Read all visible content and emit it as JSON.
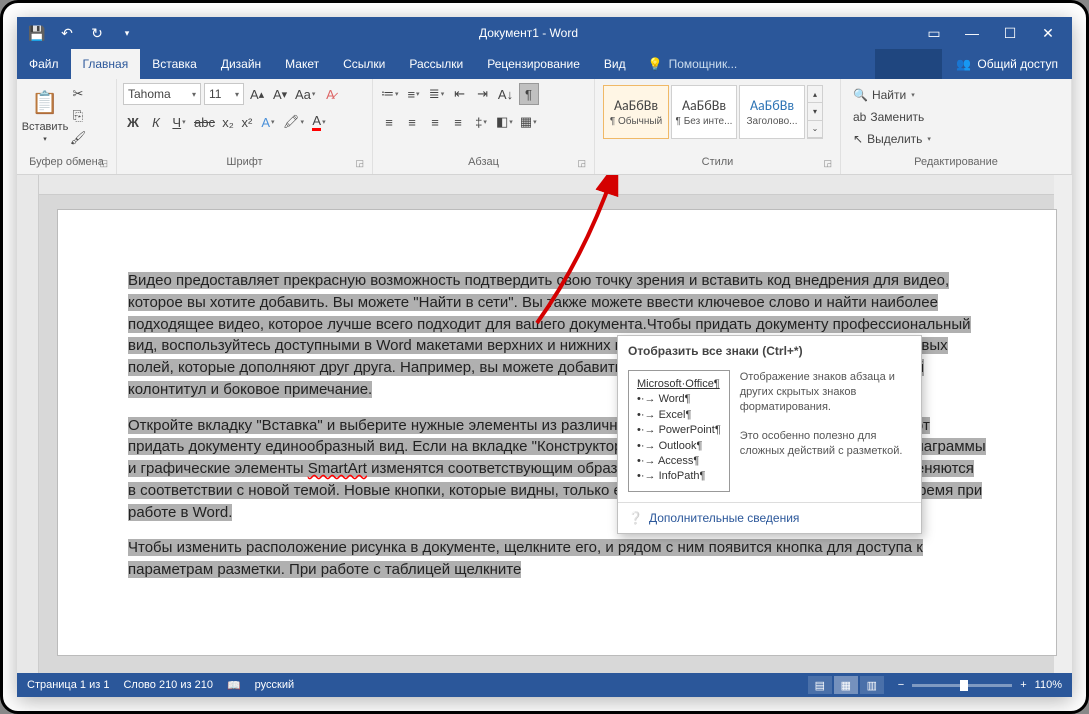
{
  "titlebar": {
    "title": "Документ1 - Word"
  },
  "tabs": {
    "file": "Файл",
    "home": "Главная",
    "insert": "Вставка",
    "design": "Дизайн",
    "layout": "Макет",
    "references": "Ссылки",
    "mailings": "Рассылки",
    "review": "Рецензирование",
    "view": "Вид",
    "tellme": "Помощник...",
    "share": "Общий доступ"
  },
  "ribbon": {
    "clipboard": {
      "label": "Буфер обмена",
      "paste": "Вставить"
    },
    "font": {
      "label": "Шрифт",
      "name": "Tahoma",
      "size": "11"
    },
    "paragraph": {
      "label": "Абзац"
    },
    "styles": {
      "label": "Стили",
      "items": [
        {
          "preview": "АаБбВв",
          "name": "¶ Обычный"
        },
        {
          "preview": "АаБбВв",
          "name": "¶ Без инте..."
        },
        {
          "preview": "АаБбВв",
          "name": "Заголово..."
        }
      ]
    },
    "editing": {
      "label": "Редактирование",
      "find": "Найти",
      "replace": "Заменить",
      "select": "Выделить"
    }
  },
  "tooltip": {
    "title": "Отобразить все знаки (Ctrl+*)",
    "sample": {
      "heading": "Microsoft·Office¶",
      "items": [
        "Word¶",
        "Excel¶",
        "PowerPoint¶",
        "Outlook¶",
        "Access¶",
        "InfoPath¶"
      ]
    },
    "desc1": "Отображение знаков абзаца и других скрытых знаков форматирования.",
    "desc2": "Это особенно полезно для сложных действий с разметкой.",
    "more": "Дополнительные сведения"
  },
  "document": {
    "p1": "Видео  предоставляет прекрасную возможность подтвердить свою точку зрения и вставить код  внедрения для видео,       которое  вы хотите добавить. Вы можете \"Найти в сети\". Вы  также можете ввести ключевое слово и найти наиболее подходящее видео, которое лучше всего подходит    для вашего документа.Чтобы  придать документу профессиональный вид, воспользуйтесь доступными в Word макетами верхних и нижних колонтитулов,       титульной страницы и текстовых   полей, которые дополняют друг друга. Например,     вы можете добавить подходящую титульную страницу, верхний колонтитул и боковое примечание.",
    "p2a": "Откройте      вкладку \"Вставка\" и выберите нужные элементы из различных коллекций.           Темы и стили также помогают придать документу единообразный вид.      Если на вкладке \"Конструктор\"      выбрать другую тему, то изображения, диаграммы и графические элементы      ",
    "p2smart": "SmartArt",
    "p2b": " изменятся соответствующим образом. При применении стилей заголовки изменяются в соответствии с новой темой. Новые кнопки, которые видны, только если       они действительно нужны, экономят время при работе в Word.",
    "p3": "Чтобы изменить     расположение рисунка в документе,      щелкните его, и рядом с ним появится кнопка для доступа к параметрам разметки.   При работе с таблицей щелкните"
  },
  "status": {
    "page": "Страница 1 из 1",
    "words": "Слово 210 из 210",
    "lang": "русский",
    "zoom": "110%"
  }
}
